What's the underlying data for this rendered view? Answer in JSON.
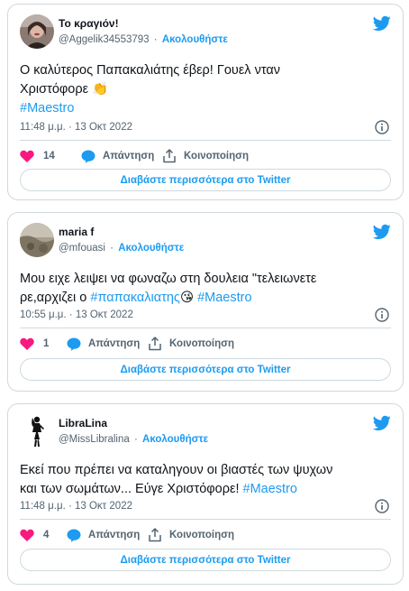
{
  "colors": {
    "accent": "#1d9bf0",
    "like": "#f91880",
    "text": "#0f1419",
    "muted": "#536471",
    "border": "#cfd9de"
  },
  "tweets": [
    {
      "name": "Το κραγιόν!",
      "handle": "@Aggelik34553793",
      "separator": "·",
      "follow_label": "Ακολουθήστε",
      "text_line1": "Ο καλύτερος Παπακαλιάτης έβερ! Γουελ νταν",
      "text_line2": "Χριστόφορε 👏",
      "hashtag": "#Maestro",
      "timestamp": "11:48 μ.μ. · 13 Οκτ 2022",
      "like_count": "14",
      "reply_label": "Απάντηση",
      "share_label": "Κοινοποίηση",
      "more_label": "Διαβάστε περισσότερα στο Twitter"
    },
    {
      "name": "maria f",
      "handle": "@mfouasi",
      "separator": "·",
      "follow_label": "Ακολουθήστε",
      "text_line1": "Μου ειχε λειψει να φωναζω στη δουλεια \"τελειωνετε",
      "text_line2_prefix": "ρε,αρχιζει ο ",
      "hashtag_inline": "#παπακαλιατης",
      "emoji": "😘",
      "hashtag": "#Maestro",
      "timestamp": "10:55 μ.μ. · 13 Οκτ 2022",
      "like_count": "1",
      "reply_label": "Απάντηση",
      "share_label": "Κοινοποίηση",
      "more_label": "Διαβάστε περισσότερα στο Twitter"
    },
    {
      "name": "LibraLina",
      "handle": "@MissLibralina",
      "separator": "·",
      "follow_label": "Ακολουθήστε",
      "text_line1": "Εκεί που πρέπει να καταληγουν οι βιαστές των ψυχων",
      "text_line2_prefix": "και των σωμάτων... Εύγε Χριστόφορε! ",
      "hashtag": "#Maestro",
      "timestamp": "11:48 μ.μ. · 13 Οκτ 2022",
      "like_count": "4",
      "reply_label": "Απάντηση",
      "share_label": "Κοινοποίηση",
      "more_label": "Διαβάστε περισσότερα στο Twitter"
    }
  ]
}
